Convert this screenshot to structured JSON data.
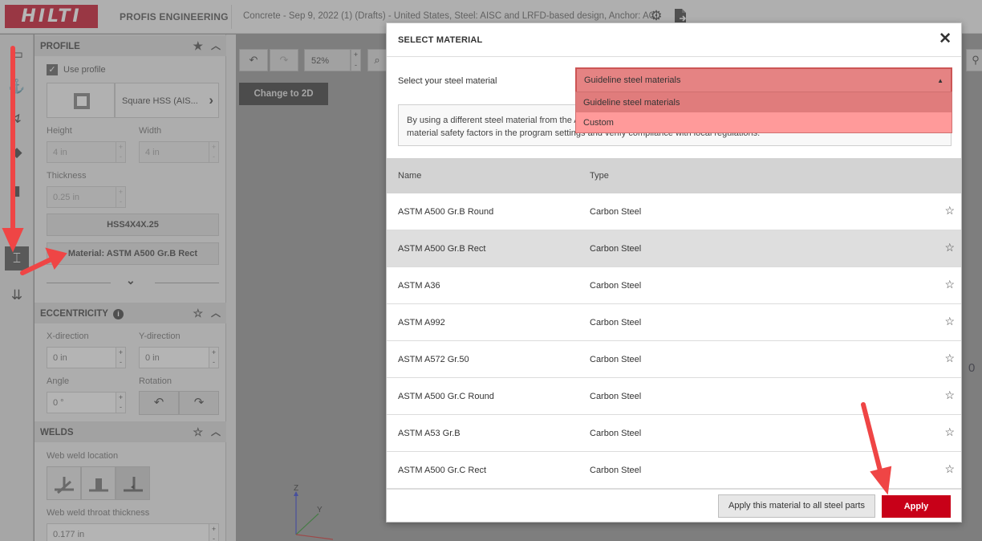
{
  "topbar": {
    "brand": "HILTI",
    "app_title": "PROFIS ENGINEERING",
    "project_title": "Concrete - Sep 9, 2022 (1) (Drafts) - United States, Steel: AISC and LRFD-based design, Anchor: ACI",
    "icons": [
      "gear-icon",
      "export-file-icon"
    ]
  },
  "iconstrip": {
    "icons": [
      "baseplate-icon",
      "anchor-icon",
      "loads-icon",
      "concrete-icon",
      "stiffener-icon",
      "profile-icon",
      "supports-icon"
    ]
  },
  "panel": {
    "profile": {
      "title": "PROFILE",
      "use_profile_label": "Use profile",
      "use_profile_checked": true,
      "shape_name": "Square HSS (AIS...",
      "height_label": "Height",
      "height_value": "4 in",
      "width_label": "Width",
      "width_value": "4 in",
      "thickness_label": "Thickness",
      "thickness_value": "0.25 in",
      "section_button": "HSS4X4X.25",
      "material_button": "Material: ASTM A500 Gr.B Rect"
    },
    "eccentricity": {
      "title": "ECCENTRICITY",
      "x_label": "X-direction",
      "x_value": "0 in",
      "y_label": "Y-direction",
      "y_value": "0 in",
      "angle_label": "Angle",
      "angle_value": "0 °",
      "rotation_label": "Rotation"
    },
    "welds": {
      "title": "WELDS",
      "web_weld_location_label": "Web weld location",
      "throat_label": "Web weld throat thickness",
      "throat_value": "0.177 in"
    }
  },
  "canvas": {
    "zoom": "52%",
    "change_2d": "Change to 2D",
    "axis_z": "Z",
    "axis_y": "Y",
    "edge_label": "0"
  },
  "modal": {
    "title": "SELECT MATERIAL",
    "select_label": "Select your steel material",
    "dropdown_value": "Guideline steel materials",
    "dropdown_options": [
      "Guideline steel materials",
      "Custom"
    ],
    "info_line1": "By using a different steel material from the A",
    "info_line2": "material safety factors in the program settings and verify compliance with local regulations.",
    "columns": [
      "Name",
      "Type"
    ],
    "rows": [
      {
        "name": "ASTM A500 Gr.B Round",
        "type": "Carbon Steel"
      },
      {
        "name": "ASTM A500 Gr.B Rect",
        "type": "Carbon Steel"
      },
      {
        "name": "ASTM A36",
        "type": "Carbon Steel"
      },
      {
        "name": "ASTM A992",
        "type": "Carbon Steel"
      },
      {
        "name": "ASTM A572 Gr.50",
        "type": "Carbon Steel"
      },
      {
        "name": "ASTM A500 Gr.C Round",
        "type": "Carbon Steel"
      },
      {
        "name": "ASTM A53 Gr.B",
        "type": "Carbon Steel"
      },
      {
        "name": "ASTM A500 Gr.C Rect",
        "type": "Carbon Steel"
      }
    ],
    "selected_row": 1,
    "apply_all_label": "Apply this material to all steel parts",
    "apply_label": "Apply"
  },
  "colors": {
    "brand_red": "#c4001a",
    "dropdown_highlight": "#e58383",
    "annotation_arrow": "#ef4545"
  }
}
